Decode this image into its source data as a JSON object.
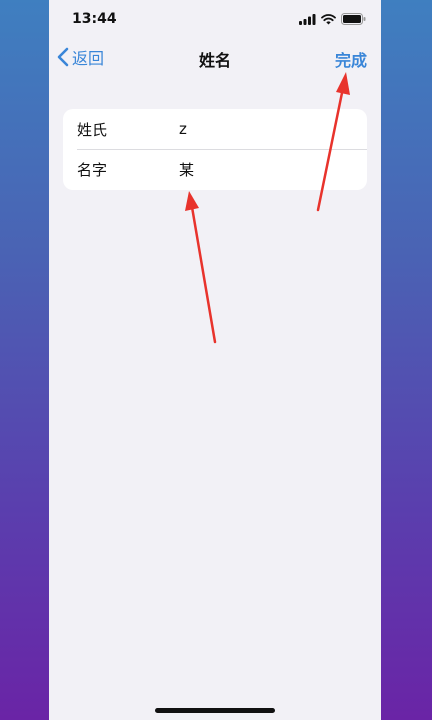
{
  "status_bar": {
    "time": "13:44",
    "icons": [
      "signal-icon",
      "wifi-icon",
      "battery-icon"
    ]
  },
  "nav": {
    "back_label": "返回",
    "title": "姓名",
    "done_label": "完成"
  },
  "form": {
    "rows": [
      {
        "label": "姓氏",
        "value": "z"
      },
      {
        "label": "名字",
        "value": "某"
      }
    ]
  },
  "colors": {
    "accent": "#3a86d8",
    "annotation": "#e8332c",
    "screen_background": "#f2f1f6"
  }
}
